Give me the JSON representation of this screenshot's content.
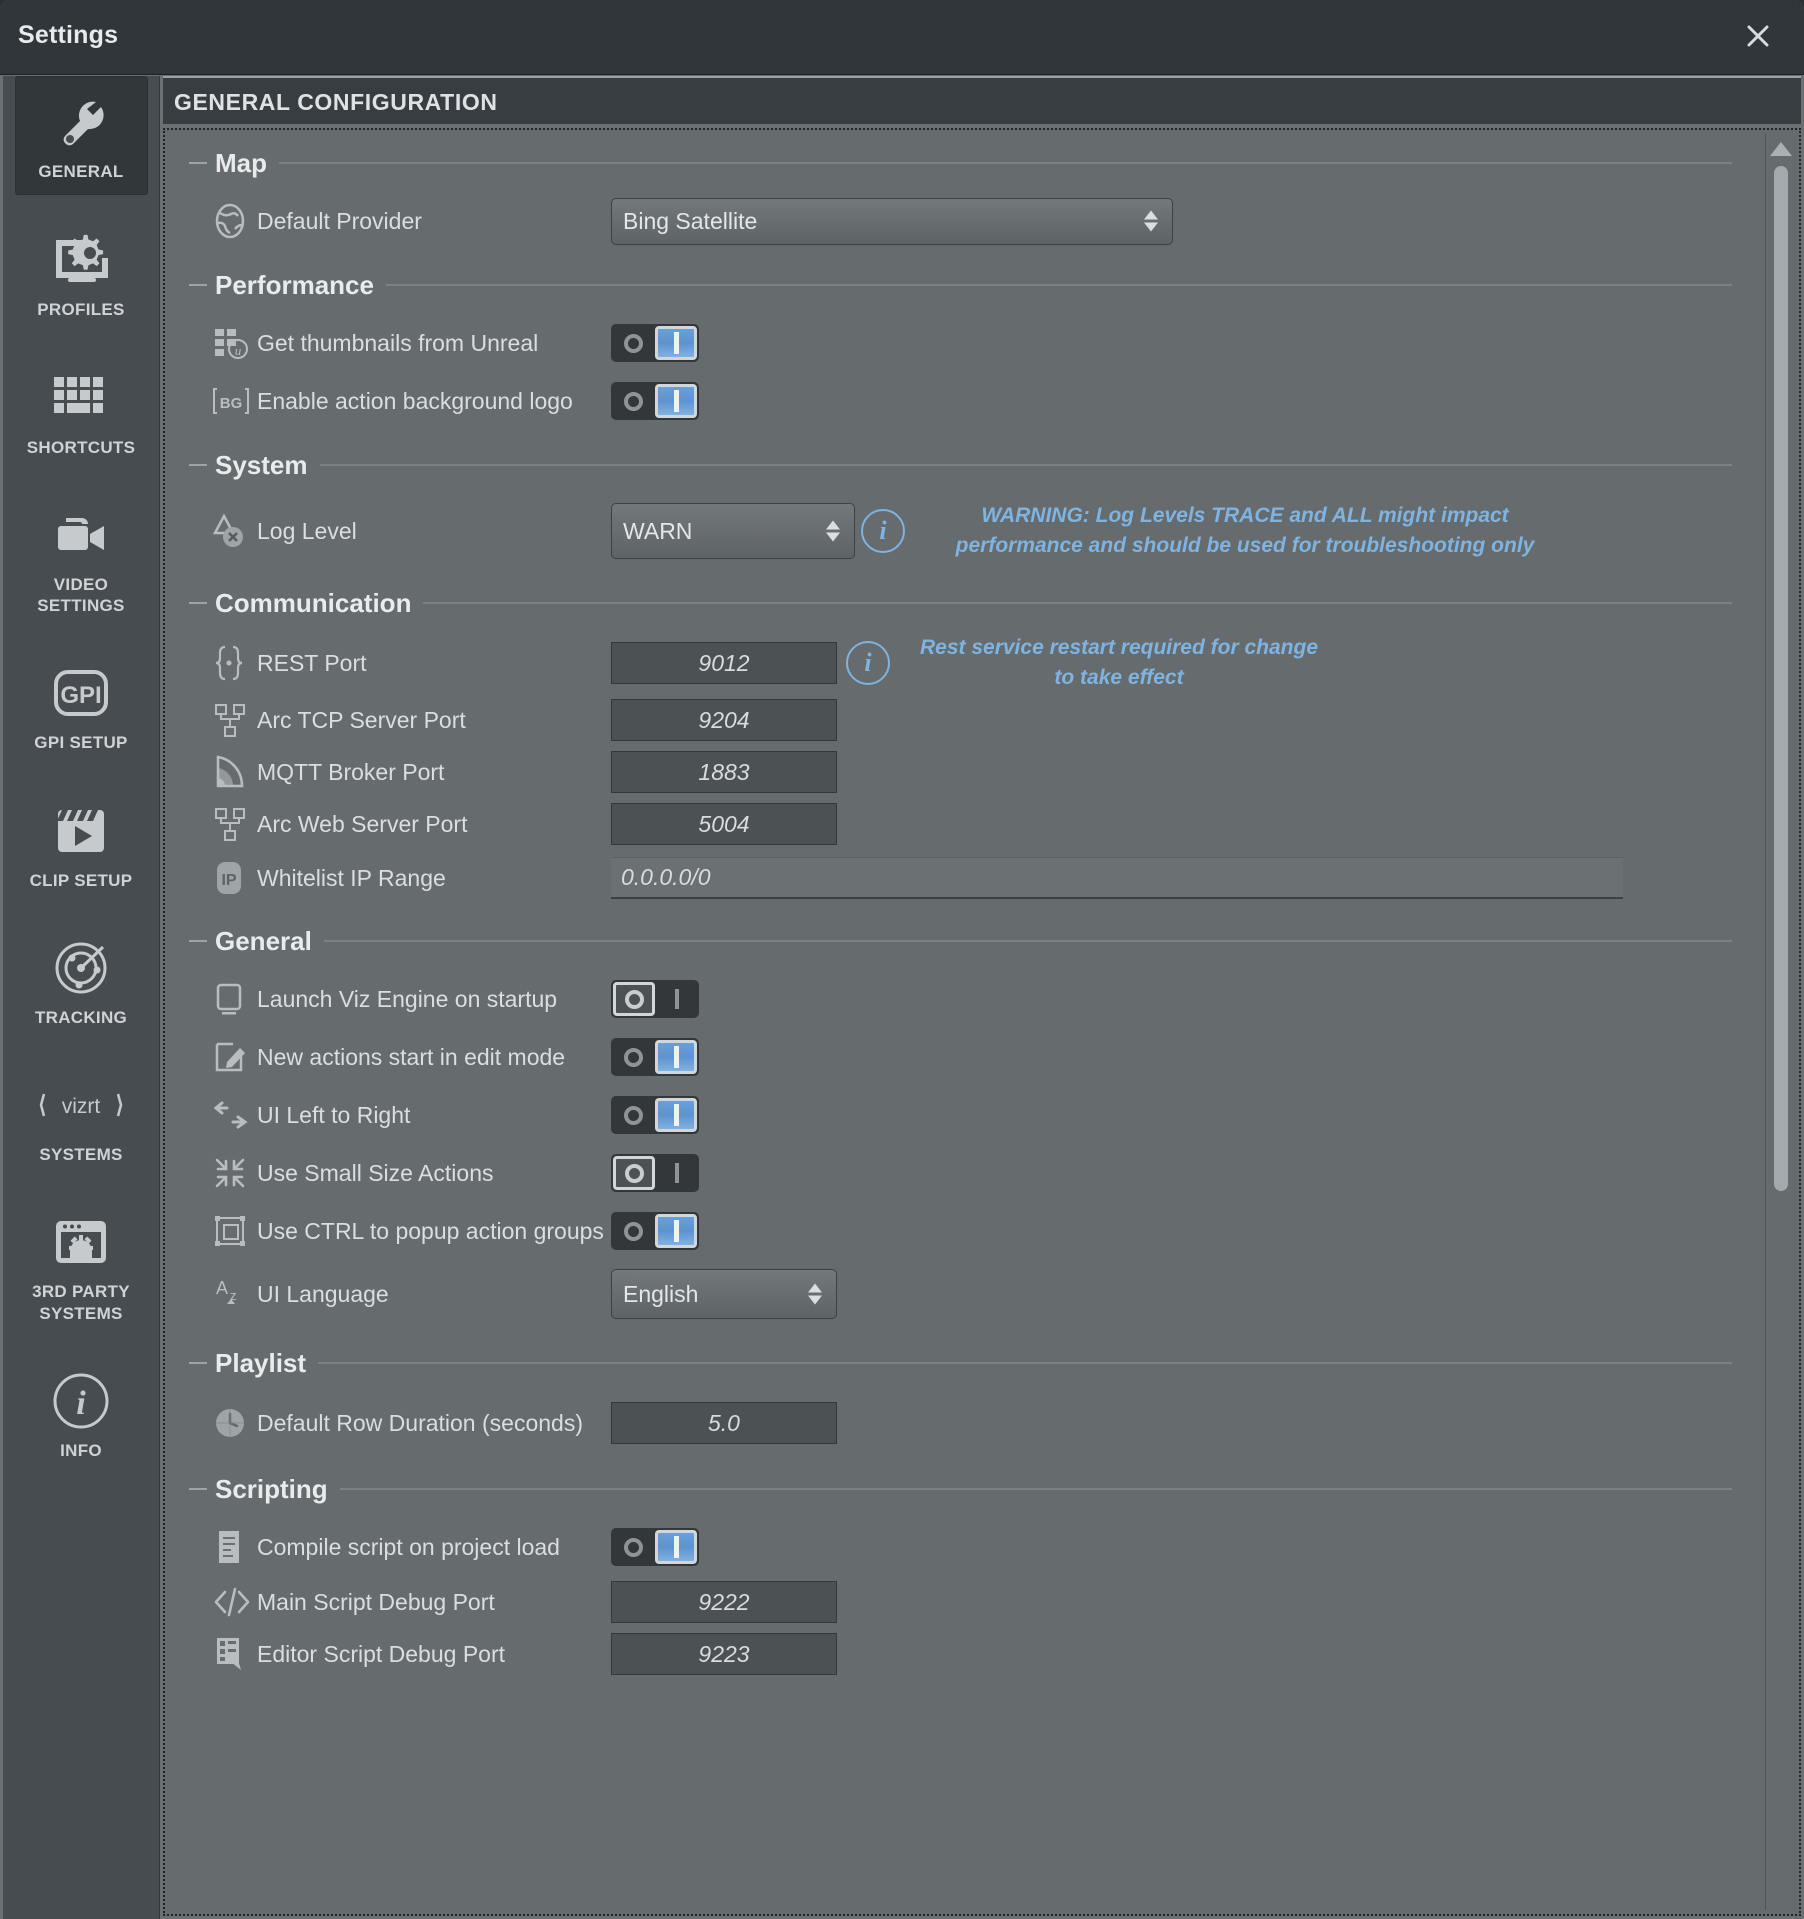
{
  "window": {
    "title": "Settings",
    "close_label": "×"
  },
  "content": {
    "header": "GENERAL CONFIGURATION"
  },
  "sidebar": {
    "items": [
      {
        "label": "GENERAL",
        "icon": "wrench-icon",
        "active": true
      },
      {
        "label": "PROFILES",
        "icon": "monitor-gear-icon",
        "active": false
      },
      {
        "label": "SHORTCUTS",
        "icon": "keyboard-icon",
        "active": false
      },
      {
        "label": "VIDEO SETTINGS",
        "icon": "video-camera-icon",
        "active": false
      },
      {
        "label": "GPI SETUP",
        "icon": "gpi-icon",
        "active": false
      },
      {
        "label": "CLIP SETUP",
        "icon": "clapperboard-icon",
        "active": false
      },
      {
        "label": "TRACKING",
        "icon": "radar-target-icon",
        "active": false
      },
      {
        "label": "SYSTEMS",
        "icon": "vizrt-logo-icon",
        "active": false
      },
      {
        "label": "3RD PARTY SYSTEMS",
        "icon": "window-gear-icon",
        "active": false
      },
      {
        "label": "INFO",
        "icon": "info-circle-icon",
        "active": false
      }
    ]
  },
  "sections": {
    "map": {
      "title": "Map",
      "default_provider": {
        "label": "Default Provider",
        "value": "Bing Satellite",
        "icon": "globe-icon"
      }
    },
    "performance": {
      "title": "Performance",
      "thumbnails": {
        "label": "Get thumbnails from Unreal",
        "state": "on",
        "icon": "unreal-thumbnails-icon"
      },
      "background_logo": {
        "label": "Enable action background logo",
        "state": "on",
        "icon": "bg-logo-icon"
      }
    },
    "system": {
      "title": "System",
      "log_level": {
        "label": "Log Level",
        "value": "WARN",
        "icon": "log-warning-icon"
      },
      "log_level_hint": "WARNING: Log Levels TRACE and ALL might impact performance and should be used for troubleshooting only"
    },
    "communication": {
      "title": "Communication",
      "rest_port": {
        "label": "REST Port",
        "value": "9012",
        "icon": "braces-icon"
      },
      "rest_port_hint": "Rest service restart required for change to take effect",
      "arc_tcp_port": {
        "label": "Arc TCP Server Port",
        "value": "9204",
        "icon": "network-icon"
      },
      "mqtt_port": {
        "label": "MQTT Broker Port",
        "value": "1883",
        "icon": "signal-waves-icon"
      },
      "arc_web_port": {
        "label": "Arc Web Server Port",
        "value": "5004",
        "icon": "network-icon"
      },
      "whitelist": {
        "label": "Whitelist IP Range",
        "value": "0.0.0.0/0",
        "icon": "ip-icon"
      }
    },
    "general": {
      "title": "General",
      "launch_viz": {
        "label": "Launch Viz Engine on startup",
        "state": "off",
        "icon": "monitor-icon"
      },
      "edit_mode": {
        "label": "New actions start in edit mode",
        "state": "on",
        "icon": "edit-pencil-icon"
      },
      "ltr": {
        "label": "UI Left to Right",
        "state": "on",
        "icon": "left-right-arrows-icon"
      },
      "small_actions": {
        "label": "Use Small Size Actions",
        "state": "off",
        "icon": "collapse-arrows-icon"
      },
      "ctrl_popup": {
        "label": "Use CTRL to popup action groups",
        "state": "on",
        "icon": "group-box-icon"
      },
      "language": {
        "label": "UI Language",
        "value": "English",
        "icon": "language-icon"
      }
    },
    "playlist": {
      "title": "Playlist",
      "row_duration": {
        "label": "Default Row Duration (seconds)",
        "value": "5.0",
        "icon": "clock-icon"
      }
    },
    "scripting": {
      "title": "Scripting",
      "compile_on_load": {
        "label": "Compile script on project load",
        "state": "on",
        "icon": "script-document-icon"
      },
      "main_debug_port": {
        "label": "Main Script Debug Port",
        "value": "9222",
        "icon": "code-tags-icon"
      },
      "editor_debug_port": {
        "label": "Editor Script Debug Port",
        "value": "9223",
        "icon": "script-editor-icon"
      }
    }
  },
  "colors": {
    "accent_blue": "#7fb3e0",
    "toggle_on": "#5d93cf",
    "panel": "#666b6e",
    "sidebar": "#474c50",
    "titlebar": "#31363a"
  }
}
